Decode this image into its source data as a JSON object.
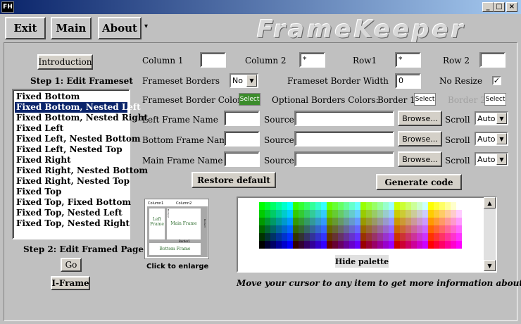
{
  "window": {
    "icon_text": "FH",
    "minimize": "_",
    "maximize": "□",
    "close": "×"
  },
  "menu": {
    "exit": "Exit",
    "main": "Main",
    "about": "About",
    "about_arrow": "▾",
    "logo": "FrameKeeper"
  },
  "left": {
    "intro_button": "Introduction",
    "step1": "Step 1:  Edit Frameset",
    "frameset_list": [
      "Fixed Bottom",
      "Fixed Bottom, Nested Left",
      "Fixed Bottom, Nested Right",
      "Fixed Left",
      "Fixed Left, Nested Bottom",
      "Fixed Left, Nested Top",
      "Fixed Right",
      "Fixed Right, Nested Bottom",
      "Fixed Right, Nested Top",
      "Fixed Top",
      "Fixed Top, Fixed Bottom",
      "Fixed Top, Nested Left",
      "Fixed Top, Nested Right"
    ],
    "selected_index": 1,
    "step2": "Step 2: Edit Framed Page",
    "go_button": "Go",
    "iframe_button": "I-Frame"
  },
  "form": {
    "column1_label": "Column 1",
    "column1_value": "",
    "column2_label": "Column 2",
    "column2_value": "*",
    "row1_label": "Row1",
    "row1_value": "*",
    "row2_label": "Row 2",
    "row2_value": "",
    "borders_label": "Frameset Borders",
    "borders_value": "No",
    "border_width_label": "Frameset Border Width",
    "border_width_value": "0",
    "noresize_label": "No Resize",
    "noresize_checked": "✓",
    "border_color_label": "Frameset Border Color",
    "border_color_select": "Select",
    "optional_label": "Optional Borders Colors:",
    "border1_label": "Border 1",
    "border1_select": "Select",
    "border2_label": "Border 2",
    "border2_select": "Select",
    "frames": [
      {
        "name_label": "Left Frame Name",
        "source_label": "Source",
        "browse": "Browse...",
        "scroll_label": "Scroll",
        "scroll_value": "Auto"
      },
      {
        "name_label": "Bottom Frame Name",
        "source_label": "Source",
        "browse": "Browse...",
        "scroll_label": "Scroll",
        "scroll_value": "Auto"
      },
      {
        "name_label": "Main Frame Name",
        "source_label": "Source",
        "browse": "Browse...",
        "scroll_label": "Scroll",
        "scroll_value": "Auto"
      }
    ],
    "restore_button": "Restore default",
    "generate_button": "Generate code"
  },
  "preview": {
    "column1": "Column1",
    "column2": "Column2",
    "left_frame": "Left Frame",
    "main_frame": "Main Frame",
    "border1": "Border1",
    "bottom_frame": "Bottom Frame",
    "border2": "Border2",
    "border3": "Border3",
    "caption": "Click to enlarge"
  },
  "palette": {
    "hide_button": "Hide palette"
  },
  "hint": "Move your cursor to any item to get more information about it",
  "colors": {
    "titlebar_start": "#0a246a",
    "selection": "#0a246a",
    "select_swatch": "#3c8c2c",
    "window_bg": "#c0c0c0"
  }
}
